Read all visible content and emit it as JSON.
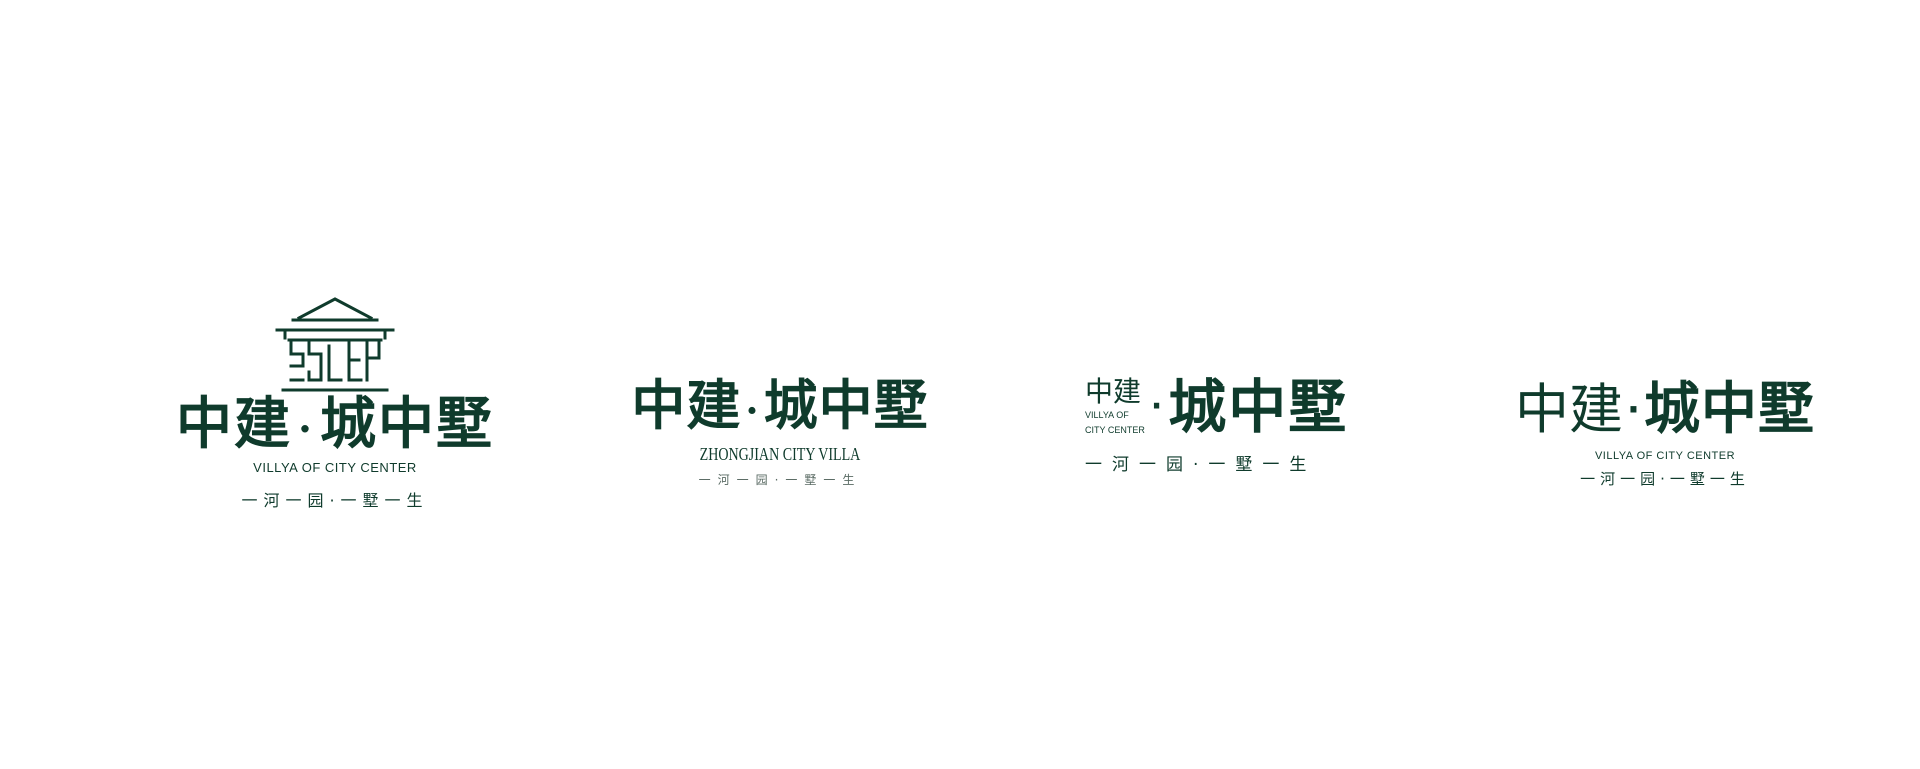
{
  "colors": {
    "brand": "#0f3b2c",
    "muted": "#5a6b64",
    "background": "#ffffff"
  },
  "logos": [
    {
      "emblem": "pavilion-emblem-icon",
      "cn_left": "中建",
      "dot": "·",
      "cn_right": "城中墅",
      "en": "VILLYA OF CITY CENTER",
      "slogan_left": "一河一园",
      "slogan_dot": "·",
      "slogan_right": "一墅一生"
    },
    {
      "cn_left": "中建",
      "dot": "·",
      "cn_right": "城中墅",
      "en": "ZHONGJIAN CITY VILLA",
      "slogan_left": "一河一园",
      "slogan_dot": "·",
      "slogan_right": "一墅一生"
    },
    {
      "cn_left": "中建",
      "en_line1": "VILLYA OF",
      "en_line2": "CITY CENTER",
      "dot": "·",
      "cn_right": "城中墅",
      "slogan_left": "一河一园",
      "slogan_dot": "·",
      "slogan_right": "一墅一生"
    },
    {
      "cn_left": "中建",
      "dot": "·",
      "cn_right": "城中墅",
      "en": "VILLYA OF CITY CENTER",
      "slogan_left": "一河一园",
      "slogan_dot": "·",
      "slogan_right": "一墅一生"
    }
  ]
}
